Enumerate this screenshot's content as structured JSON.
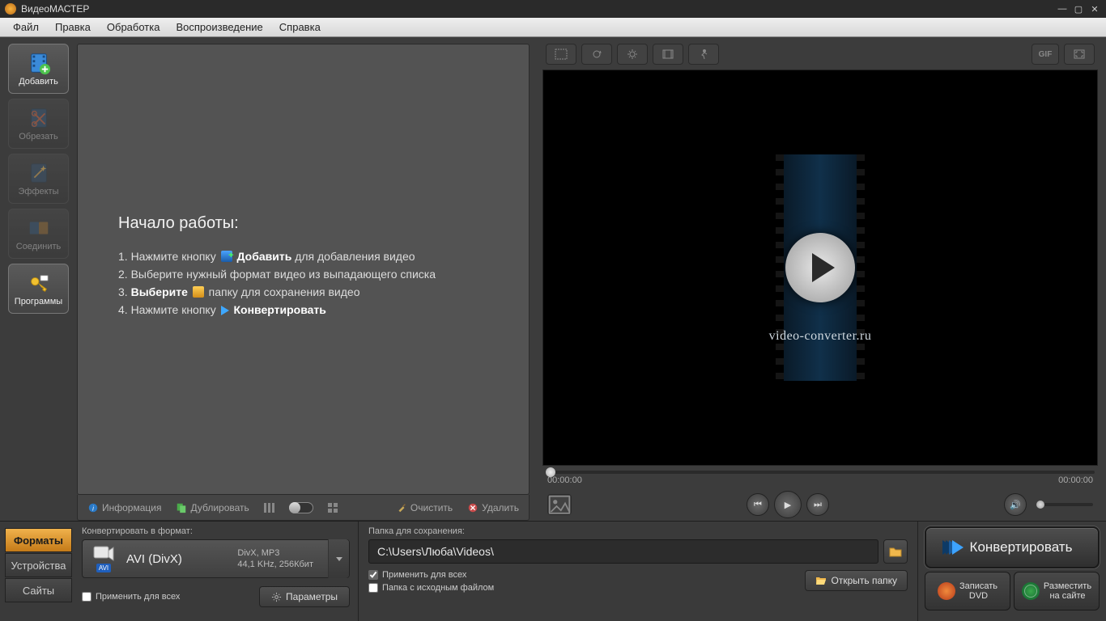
{
  "titlebar": {
    "title": "ВидеоМАСТЕР"
  },
  "menubar": [
    "Файл",
    "Правка",
    "Обработка",
    "Воспроизведение",
    "Справка"
  ],
  "tools": {
    "add": "Добавить",
    "crop": "Обрезать",
    "effects": "Эффекты",
    "join": "Соединить",
    "progs": "Программы"
  },
  "getstarted": {
    "heading": "Начало работы:",
    "l1a": "1. Нажмите кнопку ",
    "l1b": "Добавить",
    "l1c": " для добавления видео",
    "l2": "2. Выберите нужный формат видео из выпадающего списка",
    "l3a": "3. ",
    "l3b": "Выберите",
    "l3c": " папку для сохранения видео",
    "l4a": "4. Нажмите кнопку ",
    "l4b": "Конвертировать"
  },
  "liststrip": {
    "info": "Информация",
    "dup": "Дублировать",
    "clear": "Очистить",
    "delete": "Удалить"
  },
  "preview": {
    "brand": "video-converter.ru",
    "time_start": "00:00:00",
    "time_end": "00:00:00",
    "gif_label": "GIF"
  },
  "format_tabs": {
    "formats": "Форматы",
    "devices": "Устройства",
    "sites": "Сайты"
  },
  "format": {
    "section_label": "Конвертировать в формат:",
    "name": "AVI (DivX)",
    "badge": "AVI",
    "line1": "DivX, MP3",
    "line2": "44,1 KHz, 256Кбит",
    "apply_all": "Применить для всех",
    "params": "Параметры"
  },
  "dest": {
    "section_label": "Папка для сохранения:",
    "path": "C:\\Users\\Люба\\Videos\\",
    "apply_all": "Применить для всех",
    "same_folder": "Папка с исходным файлом",
    "open_folder": "Открыть папку"
  },
  "actions": {
    "convert": "Конвертировать",
    "burn_l1": "Записать",
    "burn_l2": "DVD",
    "publish_l1": "Разместить",
    "publish_l2": "на сайте"
  }
}
